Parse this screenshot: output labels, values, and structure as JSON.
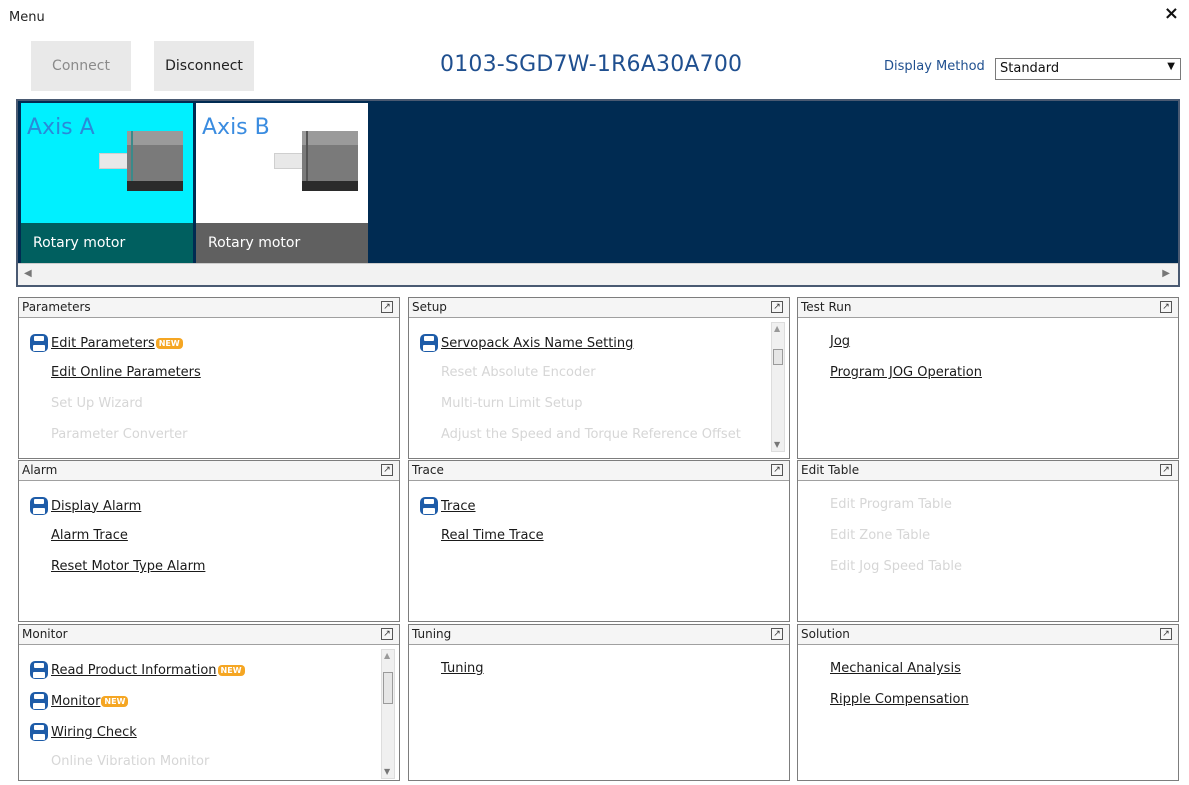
{
  "window": {
    "title": "Menu",
    "close": "×"
  },
  "toolbar": {
    "connect_label": "Connect",
    "disconnect_label": "Disconnect",
    "device_name": "0103-SGD7W-1R6A30A700",
    "display_method_label": "Display Method",
    "display_method_value": "Standard"
  },
  "axes": [
    {
      "name": "Axis A",
      "type": "Rotary motor",
      "selected": true
    },
    {
      "name": "Axis B",
      "type": "Rotary motor",
      "selected": false
    }
  ],
  "panels": {
    "parameters": {
      "title": "Parameters",
      "items": [
        {
          "label": "Edit Parameters",
          "icon": "floppy-icon",
          "badge": "NEW",
          "enabled": true
        },
        {
          "label": "Edit Online Parameters",
          "enabled": true
        },
        {
          "label": "Set Up Wizard",
          "enabled": false
        },
        {
          "label": "Parameter Converter",
          "enabled": false
        }
      ]
    },
    "setup": {
      "title": "Setup",
      "items": [
        {
          "label": "Servopack Axis Name Setting",
          "icon": "floppy-icon",
          "enabled": true
        },
        {
          "label": "Reset Absolute Encoder",
          "enabled": false
        },
        {
          "label": "Multi-turn Limit Setup",
          "enabled": false
        },
        {
          "label": "Adjust the Speed and Torque Reference Offset",
          "enabled": false
        }
      ]
    },
    "test_run": {
      "title": "Test Run",
      "items": [
        {
          "label": "Jog",
          "enabled": true
        },
        {
          "label": "Program JOG Operation",
          "enabled": true
        }
      ]
    },
    "alarm": {
      "title": "Alarm",
      "items": [
        {
          "label": "Display Alarm",
          "icon": "floppy-icon",
          "enabled": true
        },
        {
          "label": "Alarm Trace",
          "enabled": true
        },
        {
          "label": "Reset Motor Type Alarm",
          "enabled": true
        }
      ]
    },
    "trace": {
      "title": "Trace",
      "items": [
        {
          "label": "Trace",
          "icon": "floppy-icon",
          "enabled": true
        },
        {
          "label": "Real Time Trace",
          "enabled": true
        }
      ]
    },
    "edit_table": {
      "title": "Edit Table",
      "items": [
        {
          "label": "Edit Program Table",
          "enabled": false
        },
        {
          "label": "Edit Zone Table",
          "enabled": false
        },
        {
          "label": "Edit Jog Speed Table",
          "enabled": false
        }
      ]
    },
    "monitor": {
      "title": "Monitor",
      "items": [
        {
          "label": "Read Product Information",
          "icon": "floppy-icon",
          "badge": "NEW",
          "enabled": true
        },
        {
          "label": "Monitor",
          "icon": "floppy-icon",
          "badge": "NEW",
          "enabled": true
        },
        {
          "label": "Wiring Check",
          "icon": "floppy-icon",
          "enabled": true
        },
        {
          "label": "Online Vibration Monitor",
          "enabled": false
        }
      ]
    },
    "tuning": {
      "title": "Tuning",
      "items": [
        {
          "label": "Tuning",
          "enabled": true
        }
      ]
    },
    "solution": {
      "title": "Solution",
      "items": [
        {
          "label": "Mechanical Analysis",
          "enabled": true
        },
        {
          "label": "Ripple Compensation",
          "enabled": true
        }
      ]
    }
  },
  "colors": {
    "accent": "#1f4f8f",
    "strip_background": "#002b52",
    "axis_selected": "#00f0ff",
    "badge": "#f5a623"
  }
}
